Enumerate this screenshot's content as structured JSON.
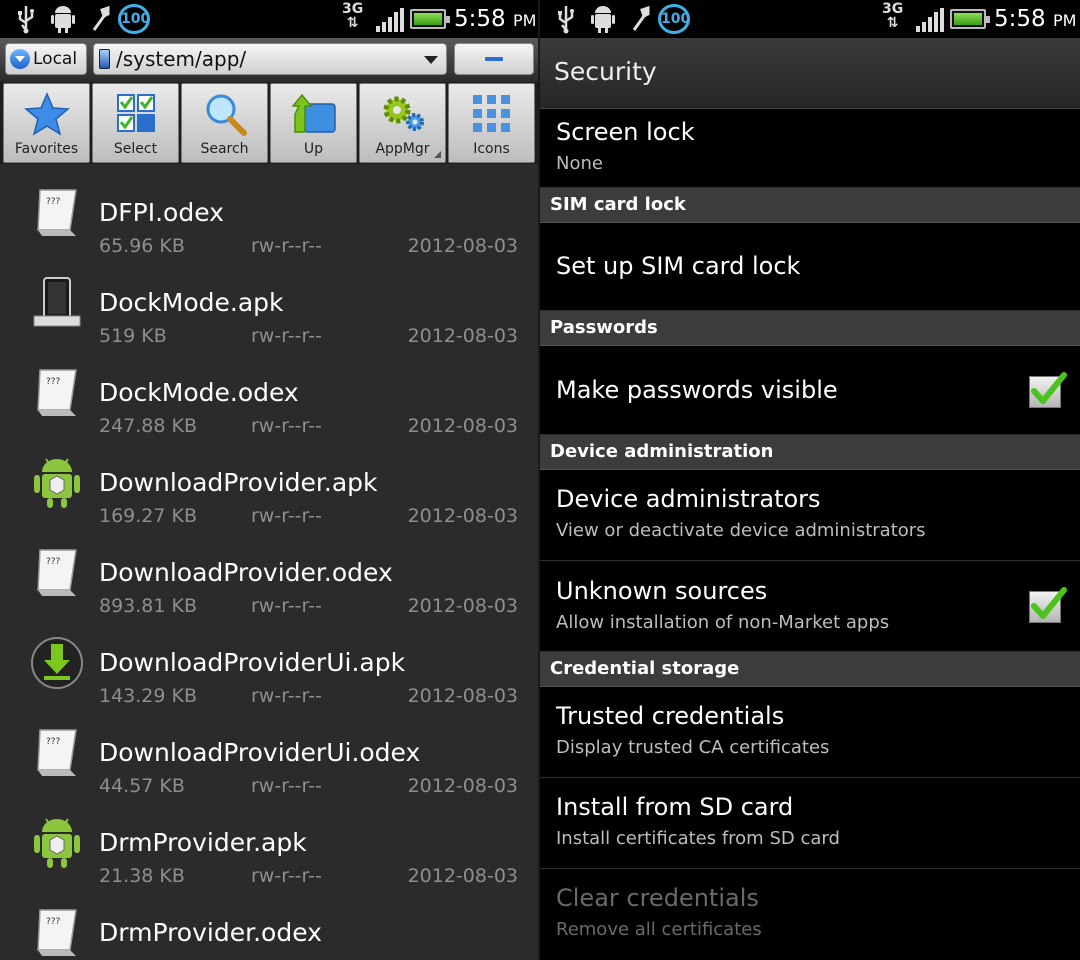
{
  "status_bar": {
    "badge": "100",
    "network": "3G",
    "time": "5:58",
    "ampm": "PM"
  },
  "file_manager": {
    "location_button": "Local",
    "path": "/system/app/",
    "toolbar": [
      {
        "label": "Favorites",
        "icon": "star-icon"
      },
      {
        "label": "Select",
        "icon": "select-grid-icon"
      },
      {
        "label": "Search",
        "icon": "magnifier-icon"
      },
      {
        "label": "Up",
        "icon": "folder-up-icon"
      },
      {
        "label": "AppMgr",
        "icon": "gears-icon"
      },
      {
        "label": "Icons",
        "icon": "icon-grid-icon"
      }
    ],
    "files": [
      {
        "name": "DFPI.odex",
        "size": "65.96 KB",
        "perm": "rw-r--r--",
        "date": "2012-08-03",
        "icon": "odex-file-icon"
      },
      {
        "name": "DockMode.apk",
        "size": "519 KB",
        "perm": "rw-r--r--",
        "date": "2012-08-03",
        "icon": "dock-phone-icon"
      },
      {
        "name": "DockMode.odex",
        "size": "247.88 KB",
        "perm": "rw-r--r--",
        "date": "2012-08-03",
        "icon": "odex-file-icon"
      },
      {
        "name": "DownloadProvider.apk",
        "size": "169.27 KB",
        "perm": "rw-r--r--",
        "date": "2012-08-03",
        "icon": "android-apk-icon"
      },
      {
        "name": "DownloadProvider.odex",
        "size": "893.81 KB",
        "perm": "rw-r--r--",
        "date": "2012-08-03",
        "icon": "odex-file-icon"
      },
      {
        "name": "DownloadProviderUi.apk",
        "size": "143.29 KB",
        "perm": "rw-r--r--",
        "date": "2012-08-03",
        "icon": "download-arrow-icon"
      },
      {
        "name": "DownloadProviderUi.odex",
        "size": "44.57 KB",
        "perm": "rw-r--r--",
        "date": "2012-08-03",
        "icon": "odex-file-icon"
      },
      {
        "name": "DrmProvider.apk",
        "size": "21.38 KB",
        "perm": "rw-r--r--",
        "date": "2012-08-03",
        "icon": "android-apk-icon"
      },
      {
        "name": "DrmProvider.odex",
        "size": "",
        "perm": "",
        "date": "",
        "icon": "odex-file-icon"
      }
    ]
  },
  "security": {
    "title": "Security",
    "screen_lock": {
      "title": "Screen lock",
      "sub": "None"
    },
    "sim_header": "SIM card lock",
    "sim_lock": {
      "title": "Set up SIM card lock"
    },
    "passwords_header": "Passwords",
    "passwords_visible": {
      "title": "Make passwords visible",
      "checked": true
    },
    "device_admin_header": "Device administration",
    "device_admins": {
      "title": "Device administrators",
      "sub": "View or deactivate device administrators"
    },
    "unknown_sources": {
      "title": "Unknown sources",
      "sub": "Allow installation of non-Market apps",
      "checked": true
    },
    "credential_header": "Credential storage",
    "trusted_credentials": {
      "title": "Trusted credentials",
      "sub": "Display trusted CA certificates"
    },
    "install_sd": {
      "title": "Install from SD card",
      "sub": "Install certificates from SD card"
    },
    "clear_credentials": {
      "title": "Clear credentials",
      "sub": "Remove all certificates"
    }
  },
  "colors": {
    "accent_blue": "#3fb0e8",
    "check_green": "#4cc21c",
    "header_bg": "#3c3c3c"
  }
}
